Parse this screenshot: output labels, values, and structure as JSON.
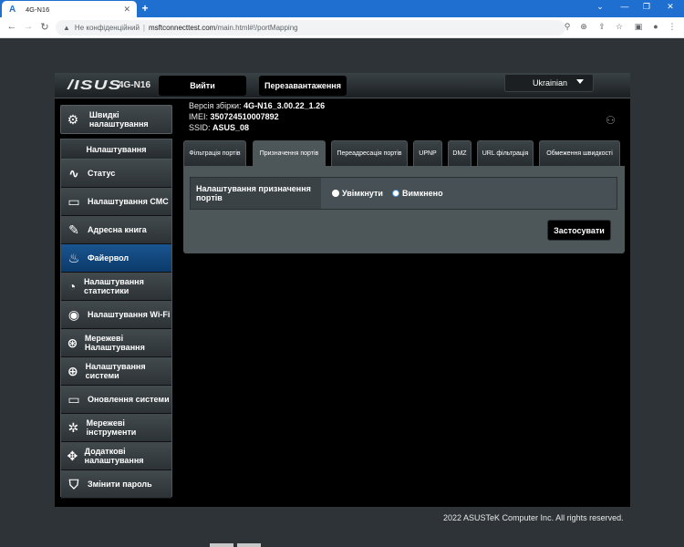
{
  "browser": {
    "tab_title": "4G-N16",
    "url_insecure": "Не конфіденційний",
    "url_host": "msftconnecttest.com",
    "url_path": "/main.html#!/portMapping"
  },
  "header": {
    "logo": "/ISUS",
    "model": "4G-N16",
    "logout": "Вийти",
    "reboot": "Перезавантаження",
    "language": "Ukrainian"
  },
  "info": {
    "build_label": "Версія збірки:",
    "build_value": "4G-N16_3.00.22_1.26",
    "imei_label": "IMEI:",
    "imei_value": "350724510007892",
    "ssid_label": "SSID:",
    "ssid_value": "ASUS_08"
  },
  "sidebar": {
    "quick_setup": "Швидкі налаштування",
    "heading": "Налаштування",
    "items": [
      {
        "label": "Статус",
        "icon": "status-icon"
      },
      {
        "label": "Налаштування СМС",
        "icon": "sms-icon"
      },
      {
        "label": "Адресна книга",
        "icon": "address-book-icon"
      },
      {
        "label": "Файервол",
        "icon": "firewall-icon"
      },
      {
        "label": "Налаштування статистики",
        "icon": "statistics-icon"
      },
      {
        "label": "Налаштування Wi-Fi",
        "icon": "wifi-icon"
      },
      {
        "label": "Мережеві Налаштування",
        "icon": "network-icon"
      },
      {
        "label": "Налаштування системи",
        "icon": "globe-icon"
      },
      {
        "label": "Оновлення системи",
        "icon": "update-icon"
      },
      {
        "label": "Мережеві інструменти",
        "icon": "tools-icon"
      },
      {
        "label": "Додаткові налаштування",
        "icon": "advanced-icon"
      },
      {
        "label": "Змінити пароль",
        "icon": "lock-icon"
      }
    ]
  },
  "tabs": [
    "Фільтрація портів",
    "Призначення портів",
    "Переадресація портів",
    "UPNP",
    "DMZ",
    "URL фільтрація",
    "Обмеження швидкості"
  ],
  "form": {
    "label": "Налаштування призначення портів",
    "option_on": "Увімкнути",
    "option_off": "Вимкнено",
    "selected": "Вимкнено",
    "apply": "Застосувати"
  },
  "footer": "2022 ASUSTeK Computer Inc. All rights reserved."
}
